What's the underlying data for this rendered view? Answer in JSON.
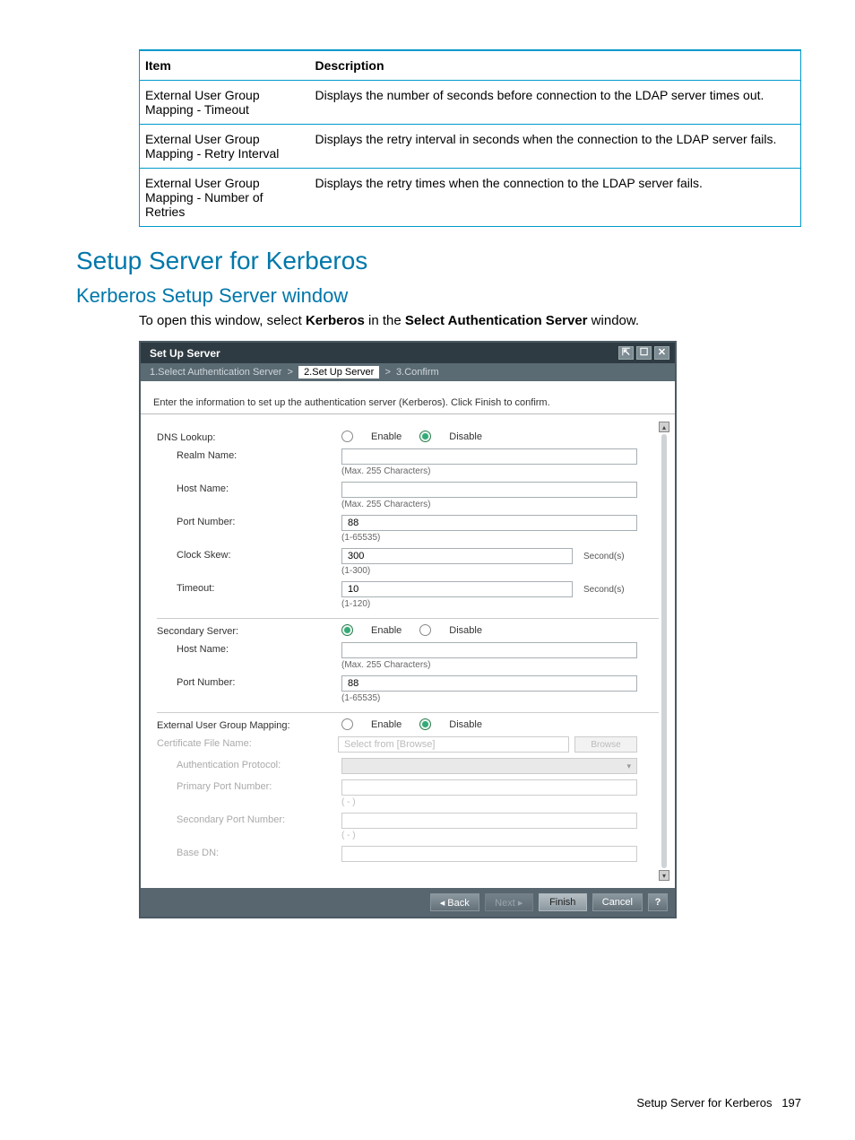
{
  "table": {
    "headers": {
      "item": "Item",
      "description": "Description"
    },
    "rows": [
      {
        "item": "External User Group Mapping - Timeout",
        "desc": "Displays the number of seconds before connection to the LDAP server times out."
      },
      {
        "item": "External User Group Mapping - Retry Interval",
        "desc": "Displays the retry interval in seconds when the connection to the LDAP server fails."
      },
      {
        "item": "External User Group Mapping - Number of Retries",
        "desc": "Displays the retry times when the connection to the LDAP server fails."
      }
    ]
  },
  "headings": {
    "h1": "Setup Server for Kerberos",
    "h2": "Kerberos Setup Server window"
  },
  "intro": {
    "prefix": "To open this window, select ",
    "kerberos": "Kerberos",
    "mid": " in the ",
    "select_auth": "Select Authentication Server",
    "suffix": " window."
  },
  "dialog": {
    "title": "Set Up Server",
    "crumbs": {
      "step1": "1.Select Authentication Server",
      "sep": ">",
      "step2": "2.Set Up Server",
      "step3": "3.Confirm"
    },
    "instruction": "Enter the information to set up the authentication server (Kerberos). Click Finish to confirm.",
    "labels": {
      "dns_lookup": "DNS Lookup:",
      "realm_name": "Realm Name:",
      "host_name": "Host Name:",
      "port_number": "Port Number:",
      "clock_skew": "Clock Skew:",
      "timeout": "Timeout:",
      "secondary_server": "Secondary Server:",
      "ext_mapping": "External User Group Mapping:",
      "cert_file": "Certificate File Name:",
      "auth_protocol": "Authentication Protocol:",
      "primary_port": "Primary Port Number:",
      "secondary_port": "Secondary Port Number:",
      "base_dn": "Base DN:"
    },
    "hints": {
      "max255": "(Max. 255 Characters)",
      "port_range": "(1-65535)",
      "clock_range": "(1-300)",
      "timeout_range": "(1-120)",
      "dash": "( - )"
    },
    "values": {
      "port": "88",
      "clock": "300",
      "timeout": "10",
      "port2": "88",
      "cert_placeholder": "Select from [Browse]"
    },
    "radio": {
      "enable": "Enable",
      "disable": "Disable"
    },
    "units": {
      "seconds": "Second(s)"
    },
    "buttons": {
      "browse": "Browse",
      "back": "◂ Back",
      "next": "Next ▸",
      "finish": "Finish",
      "cancel": "Cancel",
      "help": "?"
    }
  },
  "footer": {
    "text": "Setup Server for Kerberos",
    "page": "197"
  }
}
